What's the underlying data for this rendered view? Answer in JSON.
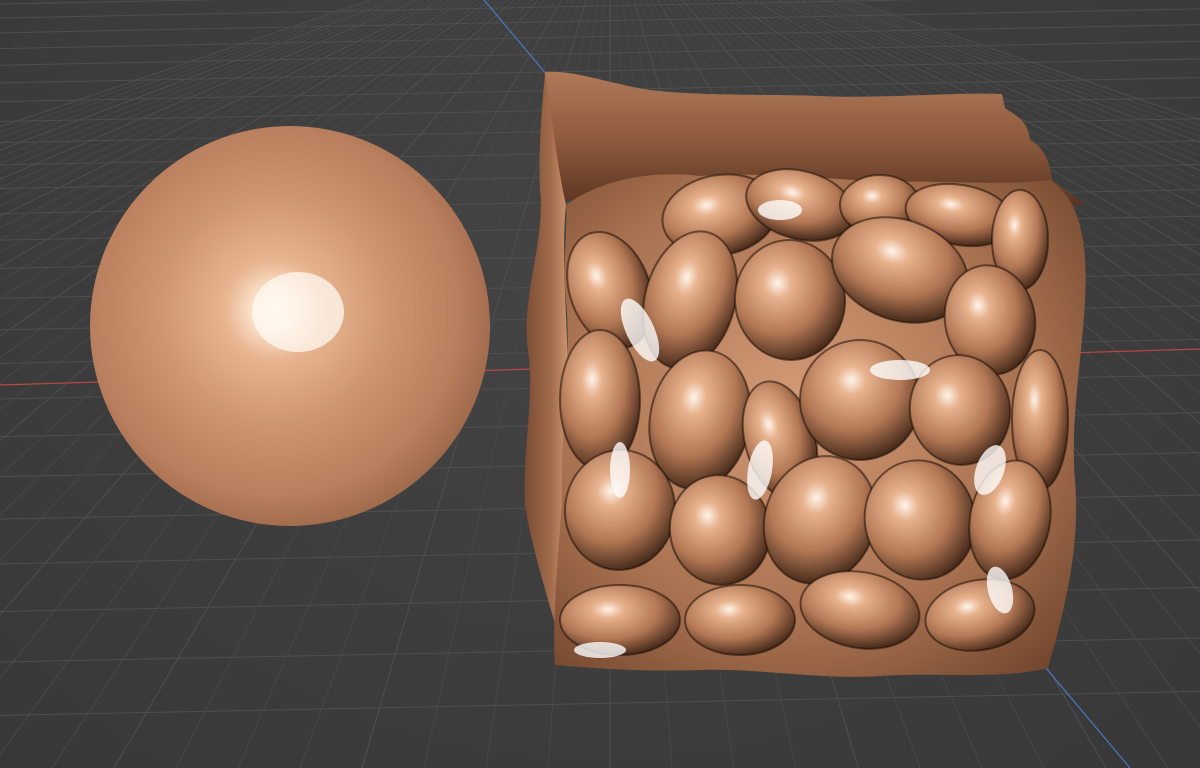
{
  "viewport": {
    "background_color": "#3d3d3d",
    "grid_color": "#4f4f4f",
    "grid_minor_color": "#474747",
    "x_axis_color": "#b84848",
    "y_axis_color": "#4a78c4"
  },
  "objects": [
    {
      "name": "sphere",
      "material": "copper",
      "color": "#c89170",
      "highlight_color": "#fff6ea"
    },
    {
      "name": "sculpted-cube",
      "material": "copper",
      "color": "#b57c5c",
      "shadow_color": "#1a0e08",
      "highlight_color": "#ffffff"
    }
  ]
}
